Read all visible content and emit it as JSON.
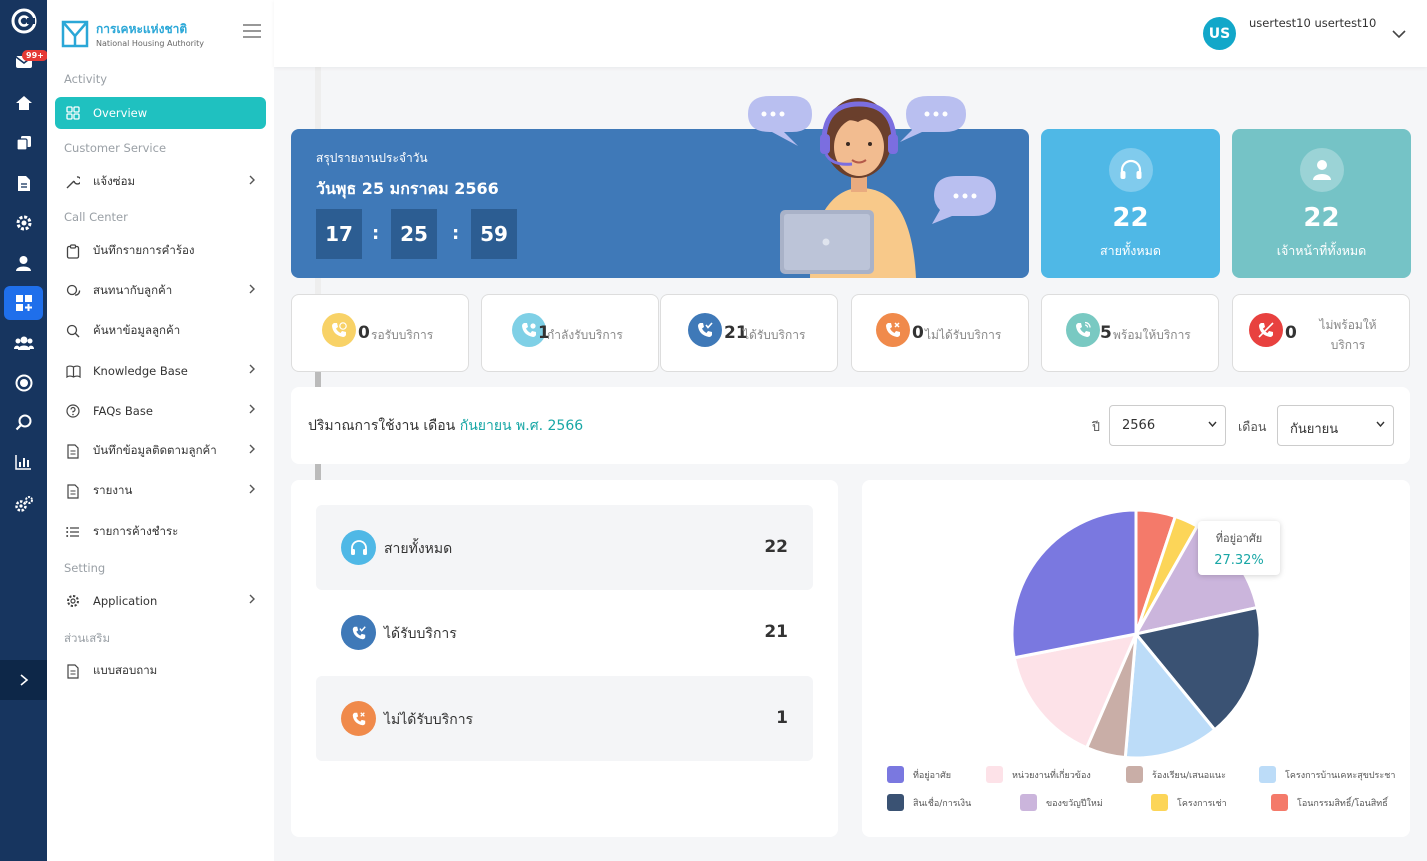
{
  "rail": {
    "badge": "99+"
  },
  "brand": {
    "name_th": "การเคหะแห่งชาติ",
    "name_en": "National Housing Authority"
  },
  "sidebar": {
    "sections": {
      "activity": "Activity",
      "customer_service": "Customer Service",
      "call_center": "Call Center",
      "setting": "Setting",
      "extra": "ส่วนเสริม"
    },
    "items": [
      {
        "label": "Overview",
        "icon": "grid-icon"
      },
      {
        "label": "แจ้งซ่อม",
        "icon": "wrench-icon"
      },
      {
        "label": "บันทึกรายการคำร้อง",
        "icon": "clipboard-icon"
      },
      {
        "label": "สนทนากับลูกค้า",
        "icon": "chat-icon"
      },
      {
        "label": "ค้นหาข้อมูลลูกค้า",
        "icon": "search-icon"
      },
      {
        "label": "Knowledge Base",
        "icon": "book-icon"
      },
      {
        "label": "FAQs Base",
        "icon": "question-icon"
      },
      {
        "label": "บันทึกข้อมูลติดตามลูกค้า",
        "icon": "document-icon"
      },
      {
        "label": "รายงาน",
        "icon": "report-icon"
      },
      {
        "label": "รายการค้างชำระ",
        "icon": "list-icon"
      },
      {
        "label": "Application",
        "icon": "gear-icon"
      },
      {
        "label": "แบบสอบถาม",
        "icon": "survey-icon"
      }
    ]
  },
  "header": {
    "avatar": "US",
    "user": "usertest10 usertest10"
  },
  "banner": {
    "title": "สรุปรายงานประจำวัน",
    "date": "วันพุธ 25 มกราคม 2566",
    "hh": "17",
    "mm": "25",
    "ss": "59",
    "sep": ":"
  },
  "stats": [
    {
      "value": "22",
      "label": "สายทั้งหมด",
      "color": "#4fb8e6"
    },
    {
      "value": "22",
      "label": "เจ้าหน้าที่ทั้งหมด",
      "color": "#75c3c6"
    }
  ],
  "status_cards": [
    {
      "value": "0",
      "label": "รอรับบริการ",
      "color": "#f8d267"
    },
    {
      "value": "1",
      "label": "กำลังรับบริการ",
      "color": "#7fd0e6"
    },
    {
      "value": "21",
      "label": "ได้รับบริการ",
      "color": "#3f79b8"
    },
    {
      "value": "0",
      "label": "ไม่ได้รับบริการ",
      "color": "#f08a4b"
    },
    {
      "value": "5",
      "label": "พร้อมให้บริการ",
      "color": "#79c9c2"
    },
    {
      "value": "0",
      "label": "ไม่พร้อมให้บริการ",
      "color": "#e8413f"
    }
  ],
  "usage": {
    "prefix": "ปริมาณการใช้งาน เดือน",
    "highlight": "กันยายน พ.ศ. 2566",
    "year_label": "ปี",
    "year": "2566",
    "month_label": "เดือน",
    "month": "กันยายน"
  },
  "summary": [
    {
      "label": "สายทั้งหมด",
      "value": "22",
      "color": "#4fb8e6"
    },
    {
      "label": "ได้รับบริการ",
      "value": "21",
      "color": "#3f79b8"
    },
    {
      "label": "ไม่ได้รับบริการ",
      "value": "1",
      "color": "#f08a4b"
    }
  ],
  "chart_data": {
    "type": "pie",
    "tooltip": {
      "label": "ที่อยู่อาศัย",
      "value": "27.32%"
    },
    "categories": [
      "โอนกรรมสิทธิ์/โอนสิทธิ์",
      "โครงการเช่า",
      "ของขวัญปีใหม่",
      "สินเชื่อ/การเงิน",
      "โครงการบ้านเคหะสุขประชา",
      "ร้องเรียน/เสนอแนะ",
      "หน่วยงานที่เกี่ยวข้อง",
      "ที่อยู่อาศัย"
    ],
    "values": [
      5,
      3,
      13,
      17,
      12,
      5,
      15,
      27.32
    ],
    "colors": [
      "#f47a6a",
      "#fcd558",
      "#cbb5dc",
      "#3a5273",
      "#bcdcf8",
      "#c9aea7",
      "#fde2e8",
      "#7a78e0"
    ],
    "legend": [
      {
        "label": "ที่อยู่อาศัย",
        "color": "#7a78e0"
      },
      {
        "label": "หน่วยงานที่เกี่ยวข้อง",
        "color": "#fde2e8"
      },
      {
        "label": "ร้องเรียน/เสนอแนะ",
        "color": "#c9aea7"
      },
      {
        "label": "โครงการบ้านเคหะสุขประชา",
        "color": "#bcdcf8"
      },
      {
        "label": "สินเชื่อ/การเงิน",
        "color": "#3a5273"
      },
      {
        "label": "ของขวัญปีใหม่",
        "color": "#cbb5dc"
      },
      {
        "label": "โครงการเช่า",
        "color": "#fcd558"
      },
      {
        "label": "โอนกรรมสิทธิ์/โอนสิทธิ์",
        "color": "#f47a6a"
      }
    ]
  }
}
